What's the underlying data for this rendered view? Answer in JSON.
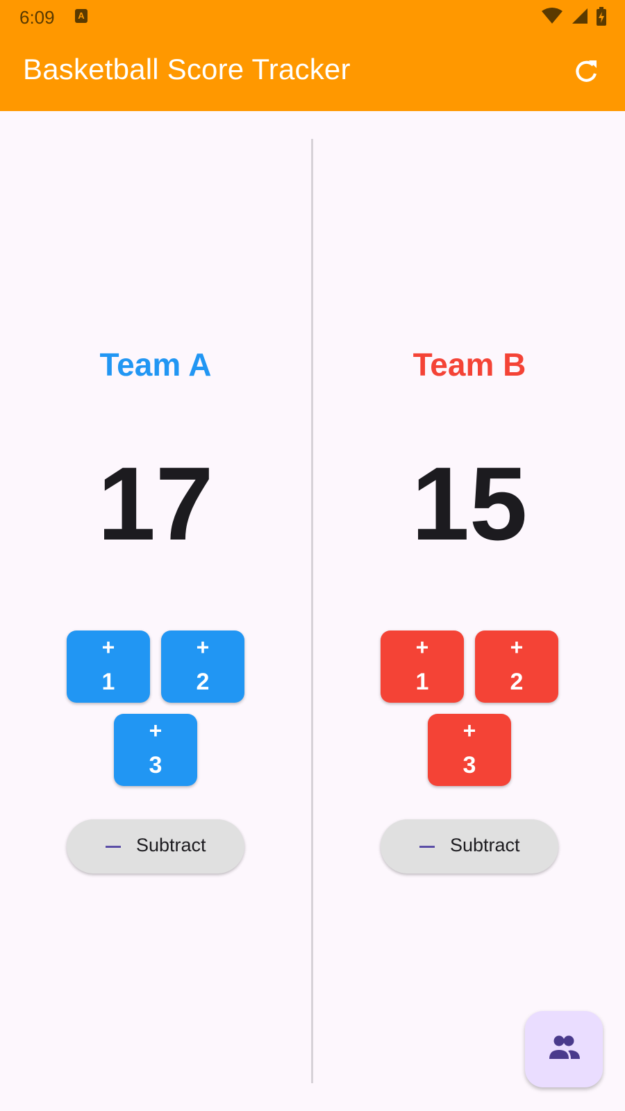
{
  "status_bar": {
    "time": "6:09",
    "app_icon_letter": "A"
  },
  "app_bar": {
    "title": "Basketball Score Tracker",
    "background": "#ff9800"
  },
  "teams": [
    {
      "name": "Team A",
      "score": "17",
      "color": "#2196f3",
      "buttons": [
        {
          "plus": "+",
          "points": "1"
        },
        {
          "plus": "+",
          "points": "2"
        },
        {
          "plus": "+",
          "points": "3"
        }
      ],
      "subtract_label": "Subtract"
    },
    {
      "name": "Team B",
      "score": "15",
      "color": "#f44336",
      "buttons": [
        {
          "plus": "+",
          "points": "1"
        },
        {
          "plus": "+",
          "points": "2"
        },
        {
          "plus": "+",
          "points": "3"
        }
      ],
      "subtract_label": "Subtract"
    }
  ],
  "icons": {
    "refresh": "refresh-icon",
    "fab": "people-icon",
    "subtract": "minus-icon"
  }
}
